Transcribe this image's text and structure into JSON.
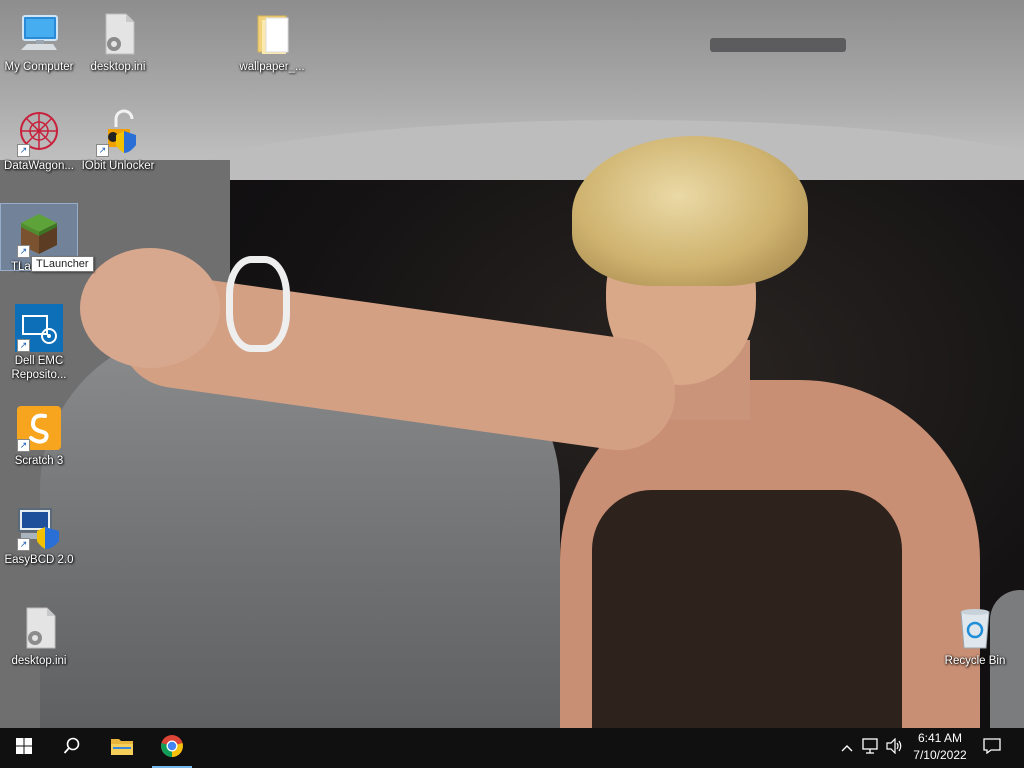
{
  "desktop": {
    "icons": [
      {
        "label": "My Computer",
        "icon": "computer-icon"
      },
      {
        "label": "desktop.ini",
        "icon": "settings-file-icon"
      },
      {
        "label": "wallpaper_...",
        "icon": "folder-icon"
      },
      {
        "label": "DataWagon...",
        "icon": "datawagon-icon"
      },
      {
        "label": "IObit Unlocker",
        "icon": "iobit-unlocker-icon"
      },
      {
        "label": "TLa",
        "icon": "minecraft-grass-block-icon"
      },
      {
        "label": "Dell EMC Reposito...",
        "icon": "dell-emc-repository-icon"
      },
      {
        "label": "Scratch 3",
        "icon": "scratch-icon"
      },
      {
        "label": "EasyBCD 2.0",
        "icon": "easybcd-icon"
      },
      {
        "label": "desktop.ini",
        "icon": "settings-file-icon"
      },
      {
        "label": "Recycle Bin",
        "icon": "recycle-bin-icon"
      }
    ],
    "tooltip": "TLauncher"
  },
  "taskbar": {
    "buttons": [
      {
        "name": "start-button",
        "icon": "windows-logo-icon"
      },
      {
        "name": "search-button",
        "icon": "search-icon"
      },
      {
        "name": "file-explorer-button",
        "icon": "folder-icon"
      },
      {
        "name": "chrome-button",
        "icon": "chrome-icon"
      }
    ],
    "tray": {
      "chevron": "^",
      "time": "6:41 AM",
      "date": "7/10/2022"
    }
  },
  "colors": {
    "taskbar_bg": "#101010",
    "active_indicator": "#76b9ed"
  }
}
